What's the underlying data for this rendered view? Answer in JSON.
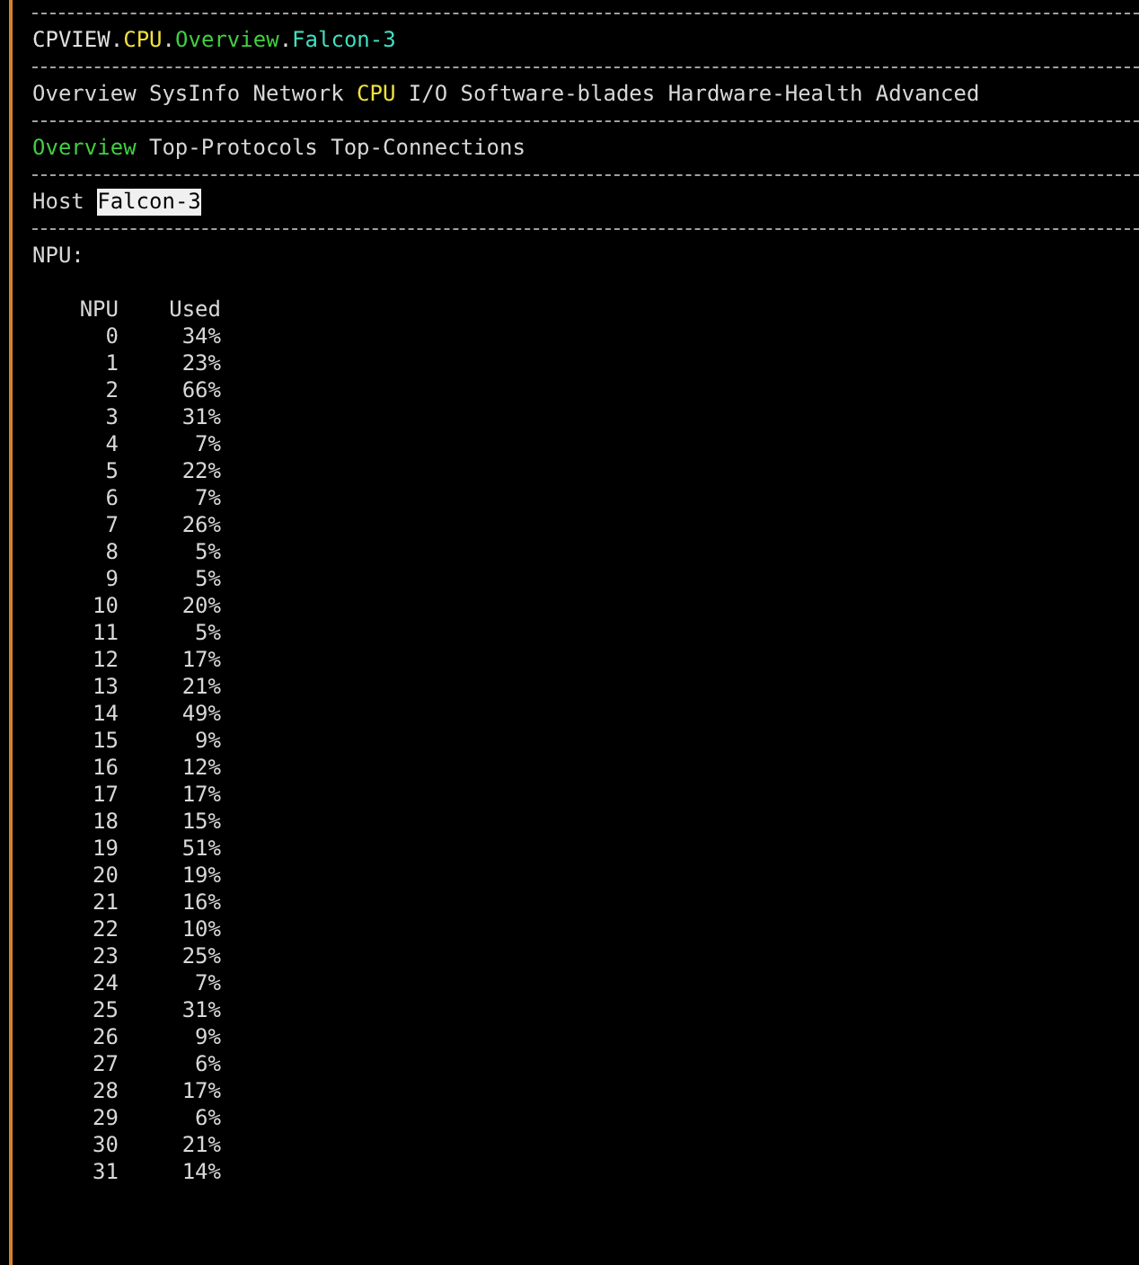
{
  "breadcrumb": {
    "separator": ".",
    "segments": [
      {
        "text": "CPVIEW",
        "color": "#e0e0e0"
      },
      {
        "text": "CPU",
        "color": "#f0e040"
      },
      {
        "text": "Overview",
        "color": "#40d040"
      },
      {
        "text": "Falcon-3",
        "color": "#40e0c0"
      }
    ]
  },
  "menu": [
    {
      "label": "Overview",
      "selected": false
    },
    {
      "label": "SysInfo",
      "selected": false
    },
    {
      "label": "Network",
      "selected": false
    },
    {
      "label": "CPU",
      "selected": true
    },
    {
      "label": "I/O",
      "selected": false
    },
    {
      "label": "Software-blades",
      "selected": false
    },
    {
      "label": "Hardware-Health",
      "selected": false
    },
    {
      "label": "Advanced",
      "selected": false
    }
  ],
  "submenu": [
    {
      "label": "Overview",
      "selected": true
    },
    {
      "label": "Top-Protocols",
      "selected": false
    },
    {
      "label": "Top-Connections",
      "selected": false
    }
  ],
  "host": {
    "label": "Host",
    "value": "Falcon-3"
  },
  "section_title": "NPU:",
  "table": {
    "columns": [
      "NPU",
      "Used"
    ],
    "rows": [
      [
        "0",
        "34%"
      ],
      [
        "1",
        "23%"
      ],
      [
        "2",
        "66%"
      ],
      [
        "3",
        "31%"
      ],
      [
        "4",
        "7%"
      ],
      [
        "5",
        "22%"
      ],
      [
        "6",
        "7%"
      ],
      [
        "7",
        "26%"
      ],
      [
        "8",
        "5%"
      ],
      [
        "9",
        "5%"
      ],
      [
        "10",
        "20%"
      ],
      [
        "11",
        "5%"
      ],
      [
        "12",
        "17%"
      ],
      [
        "13",
        "21%"
      ],
      [
        "14",
        "49%"
      ],
      [
        "15",
        "9%"
      ],
      [
        "16",
        "12%"
      ],
      [
        "17",
        "17%"
      ],
      [
        "18",
        "15%"
      ],
      [
        "19",
        "51%"
      ],
      [
        "20",
        "19%"
      ],
      [
        "21",
        "16%"
      ],
      [
        "22",
        "10%"
      ],
      [
        "23",
        "25%"
      ],
      [
        "24",
        "7%"
      ],
      [
        "25",
        "31%"
      ],
      [
        "26",
        "9%"
      ],
      [
        "27",
        "6%"
      ],
      [
        "28",
        "17%"
      ],
      [
        "29",
        "6%"
      ],
      [
        "30",
        "21%"
      ],
      [
        "31",
        "14%"
      ]
    ]
  }
}
